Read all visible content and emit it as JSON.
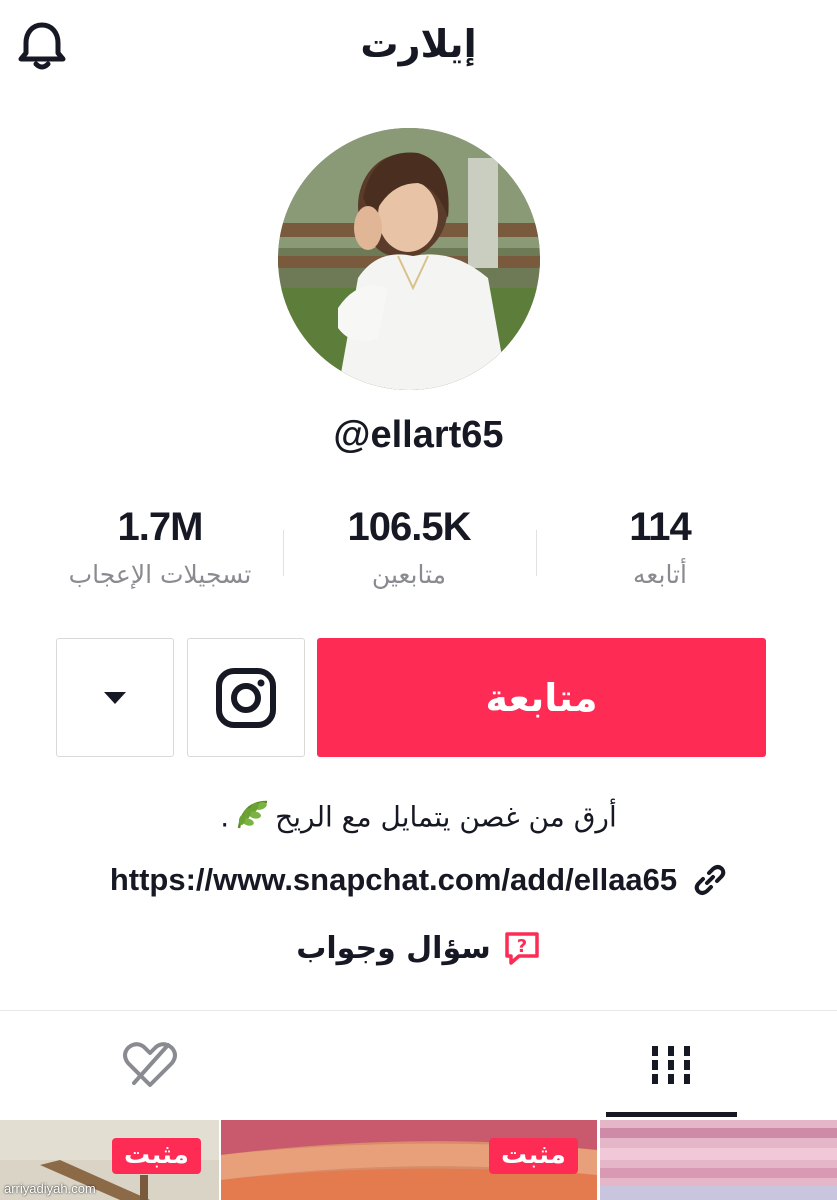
{
  "header": {
    "title": "إيلارت"
  },
  "profile": {
    "username": "@ellart65"
  },
  "stats": {
    "likes": {
      "value": "1.7M",
      "label": "تسجيلات الإعجاب"
    },
    "followers": {
      "value": "106.5K",
      "label": "متابعين"
    },
    "following": {
      "value": "114",
      "label": "أتابعه"
    }
  },
  "actions": {
    "follow_label": "متابعة"
  },
  "bio": {
    "text": "أرق من غصن يتمايل مع الريح",
    "end_punctuation": "."
  },
  "link": {
    "url": "https://www.snapchat.com/add/ellaa65"
  },
  "qa": {
    "label": "سؤال وجواب"
  },
  "videos": {
    "pinned_label": "مثبت"
  },
  "watermark": "arriyadiyah.com",
  "colors": {
    "accent": "#fe2c55",
    "text": "#161823",
    "muted": "#8a8b91"
  }
}
